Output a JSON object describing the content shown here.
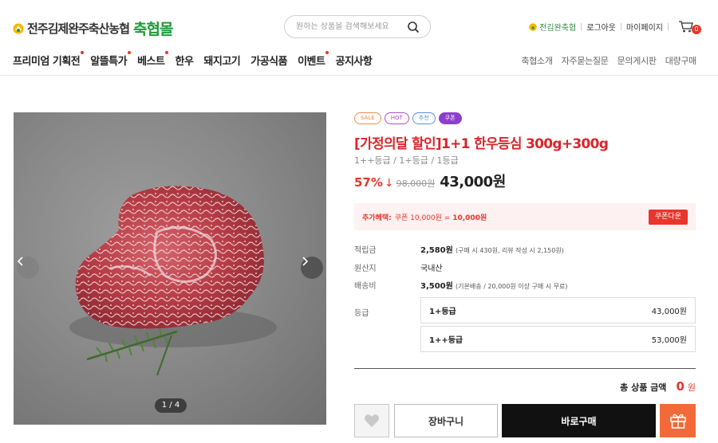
{
  "header": {
    "logo_text": "전주김제완주축산농협",
    "logo_mall": "축협몰",
    "search_placeholder": "원하는 상품을 검색해보세요",
    "util": {
      "store": "전김완축협",
      "logout": "로그아웃",
      "mypage": "마이페이지",
      "cart_count": "0"
    },
    "gnb": [
      {
        "label": "프리미엄 기획전",
        "dot": true
      },
      {
        "label": "알뜰특가",
        "dot": true
      },
      {
        "label": "베스트",
        "dot": true
      },
      {
        "label": "한우",
        "dot": false
      },
      {
        "label": "돼지고기",
        "dot": false
      },
      {
        "label": "가공식품",
        "dot": false
      },
      {
        "label": "이벤트",
        "dot": true
      },
      {
        "label": "공지사항",
        "dot": false
      }
    ],
    "snb": [
      "축협소개",
      "자주묻는질문",
      "문의게시판",
      "대량구매"
    ]
  },
  "gallery": {
    "counter": "1 / 4"
  },
  "product": {
    "badges": [
      "SALE",
      "HOT",
      "추천",
      "쿠폰"
    ],
    "title": "[가정의달 할인]1+1 한우등심 300g+300g",
    "subtitle": "1++등급 / 1+등급 / 1등급",
    "discount_rate": "57%",
    "discount_arrow": "↓",
    "original_price": "98,000원",
    "price": "43,000원",
    "benefit": {
      "label": "추가혜택:",
      "coupon": "쿠폰 10,000원 =",
      "total": "10,000원",
      "button": "쿠폰다운"
    },
    "info": {
      "points_label": "적립금",
      "points_value": "2,580원",
      "points_sub": "(구매 시 430원, 리뷰 작성 시 2,150원)",
      "origin_label": "원산지",
      "origin_value": "국내산",
      "shipping_label": "배송비",
      "shipping_value": "3,500원",
      "shipping_sub": "(기본배송 / 20,000원 이상 구매 시 무료)",
      "grade_label": "등급"
    },
    "options": [
      {
        "name": "1+등급",
        "price": "43,000원"
      },
      {
        "name": "1++등급",
        "price": "53,000원"
      }
    ],
    "total": {
      "label": "총 상품 금액",
      "value": "0",
      "unit": "원"
    },
    "buttons": {
      "cart": "장바구니",
      "buy": "바로구매"
    }
  },
  "colors": {
    "accent_red": "#e8362d",
    "brand_green": "#1f9a3a",
    "gift_orange": "#f26a3a"
  }
}
